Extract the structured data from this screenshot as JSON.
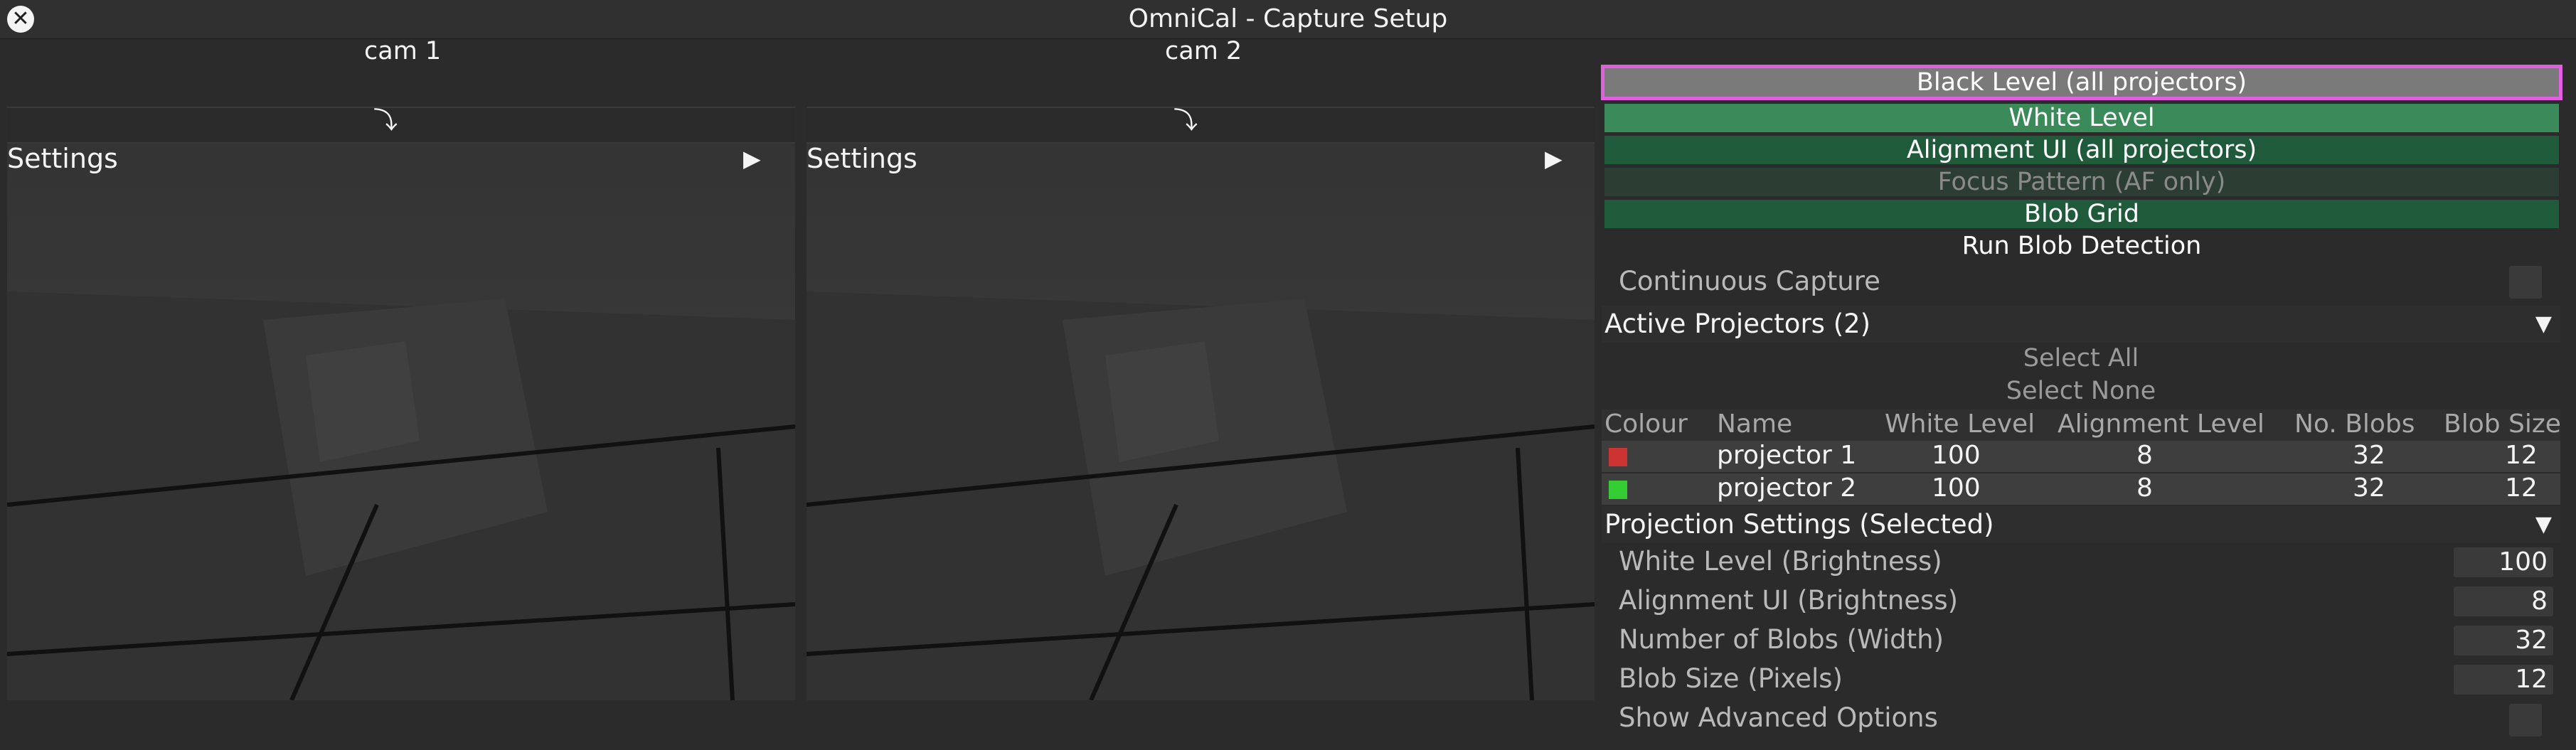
{
  "window": {
    "title": "OmniCal - Capture Setup",
    "close_icon": "close-icon"
  },
  "cameras": [
    {
      "label": "cam 1",
      "settings_label": "Settings",
      "rotate_icon": "rotate-icon",
      "expand_icon": "play-icon"
    },
    {
      "label": "cam 2",
      "settings_label": "Settings",
      "rotate_icon": "rotate-icon",
      "expand_icon": "play-icon"
    }
  ],
  "actions": {
    "black_level": "Black Level (all projectors)",
    "white_level": "White Level",
    "alignment_ui": "Alignment UI (all projectors)",
    "focus_pattern": "Focus Pattern (AF only)",
    "blob_grid": "Blob Grid",
    "run_blob_detection": "Run Blob Detection"
  },
  "continuous_capture": {
    "label": "Continuous Capture",
    "checked": false
  },
  "active_projectors": {
    "header": "Active Projectors (2)",
    "select_all": "Select All",
    "select_none": "Select None",
    "columns": [
      "Colour",
      "Name",
      "White Level",
      "Alignment Level",
      "No. Blobs",
      "Blob Size"
    ],
    "rows": [
      {
        "colour": "#cc3333",
        "name": "projector 1",
        "white_level": "100",
        "alignment_level": "8",
        "blobs": "32",
        "blob_size": "12"
      },
      {
        "colour": "#33cc33",
        "name": "projector 2",
        "white_level": "100",
        "alignment_level": "8",
        "blobs": "32",
        "blob_size": "12"
      }
    ]
  },
  "projection_settings": {
    "header": "Projection Settings (Selected)",
    "fields": [
      {
        "label": "White Level (Brightness)",
        "value": "100"
      },
      {
        "label": "Alignment UI (Brightness)",
        "value": "8"
      },
      {
        "label": "Number of Blobs (Width)",
        "value": "32"
      },
      {
        "label": "Blob Size (Pixels)",
        "value": "12"
      }
    ],
    "show_advanced": {
      "label": "Show Advanced Options",
      "checked": false
    }
  },
  "colors": {
    "accent_outline": "#e060e0",
    "white_level_btn": "#3a8a5a",
    "dark_green_btn": "#1f5a3a",
    "focus_btn": "#2c3e34"
  }
}
